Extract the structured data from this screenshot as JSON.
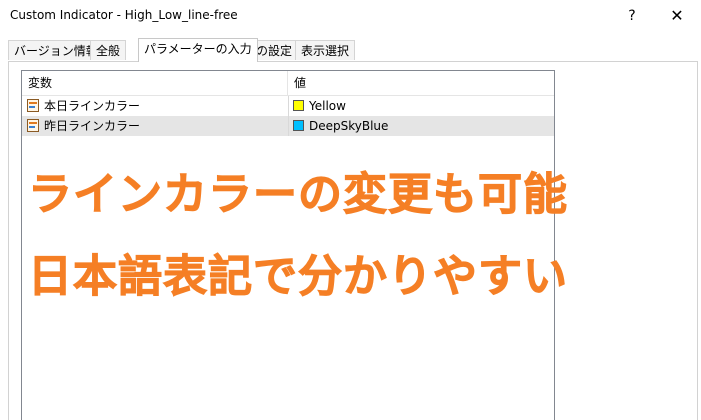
{
  "window": {
    "title": "Custom Indicator - High_Low_line-free",
    "help_label": "?",
    "close_label": "✕"
  },
  "tabs": [
    {
      "label": "バージョン情報",
      "active": false
    },
    {
      "label": "全般",
      "active": false
    },
    {
      "label": "パラメーターの入力",
      "active": true
    },
    {
      "label": "色の設定",
      "active": false
    },
    {
      "label": "表示選択",
      "active": false
    }
  ],
  "table": {
    "columns": [
      "変数",
      "値"
    ],
    "rows": [
      {
        "name": "本日ラインカラー",
        "value": "Yellow",
        "color": "#FFFF00"
      },
      {
        "name": "昨日ラインカラー",
        "value": "DeepSkyBlue",
        "color": "#00BFFF"
      }
    ]
  },
  "overlay": {
    "line1": "ラインカラーの変更も可能",
    "line2": "日本語表記で分かりやすい",
    "color": "#F57F25"
  }
}
